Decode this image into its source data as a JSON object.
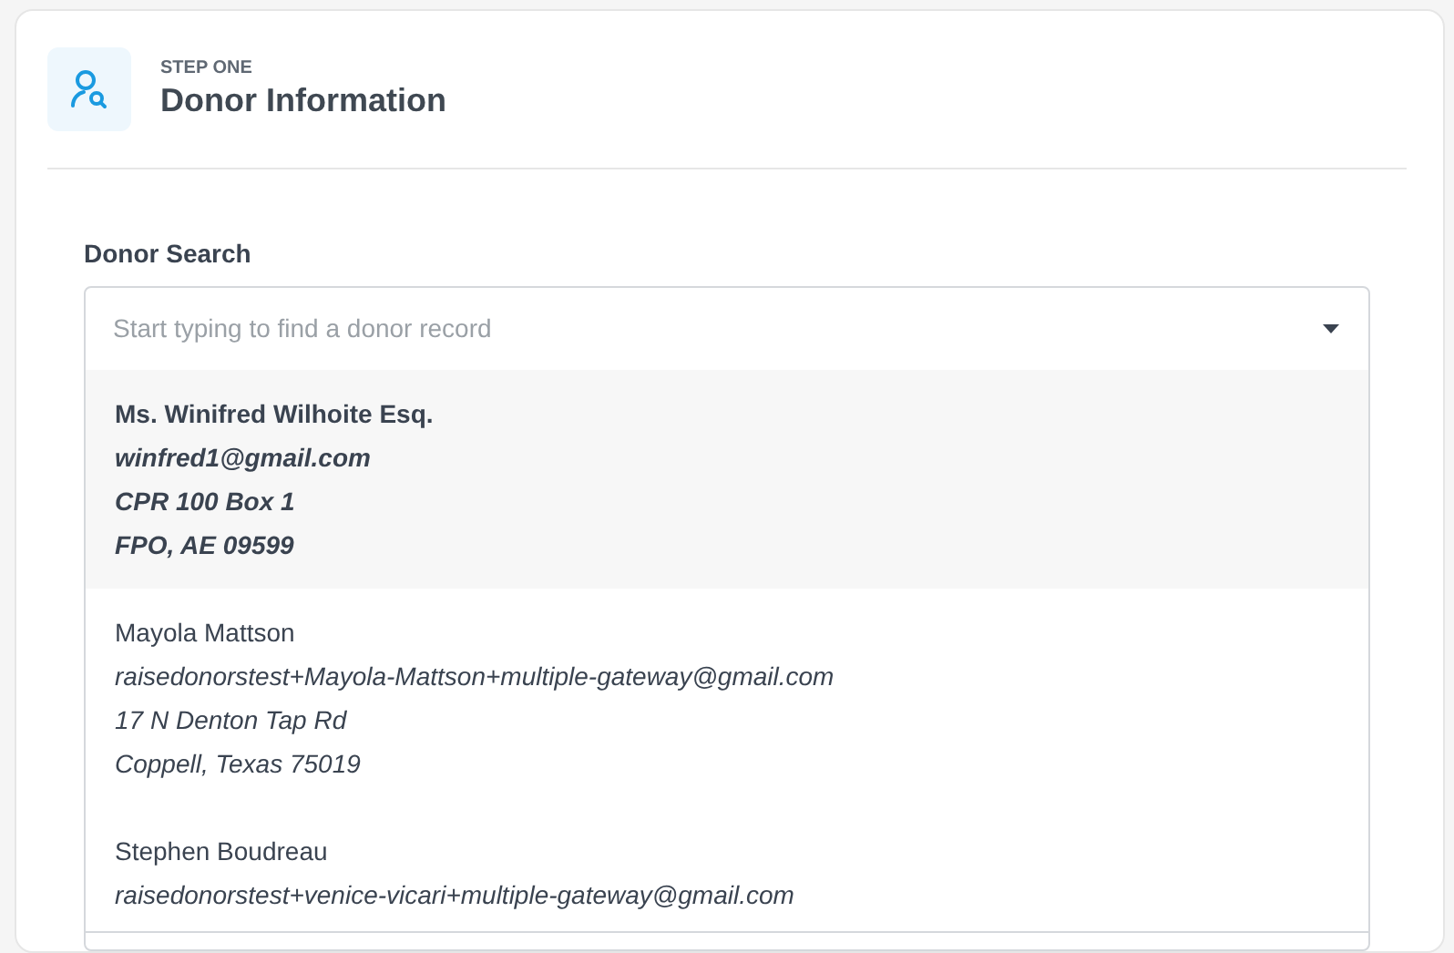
{
  "header": {
    "step": "STEP ONE",
    "title": "Donor Information"
  },
  "donor_search": {
    "label": "Donor Search",
    "placeholder": "Start typing to find a donor record",
    "expanded": true,
    "options": [
      {
        "name": "Ms. Winifred Wilhoite Esq.",
        "email": "winfred1@gmail.com",
        "address_lines": [
          "CPR 100 Box 1",
          "FPO, AE 09599"
        ],
        "selected": true
      },
      {
        "name": "Mayola Mattson",
        "email": "raisedonorstest+Mayola-Mattson+multiple-gateway@gmail.com",
        "address_lines": [
          "17 N Denton Tap Rd",
          "Coppell, Texas 75019"
        ],
        "selected": false
      },
      {
        "name": "Stephen Boudreau",
        "email": "raisedonorstest+venice-vicari+multiple-gateway@gmail.com",
        "selected": false
      }
    ]
  }
}
